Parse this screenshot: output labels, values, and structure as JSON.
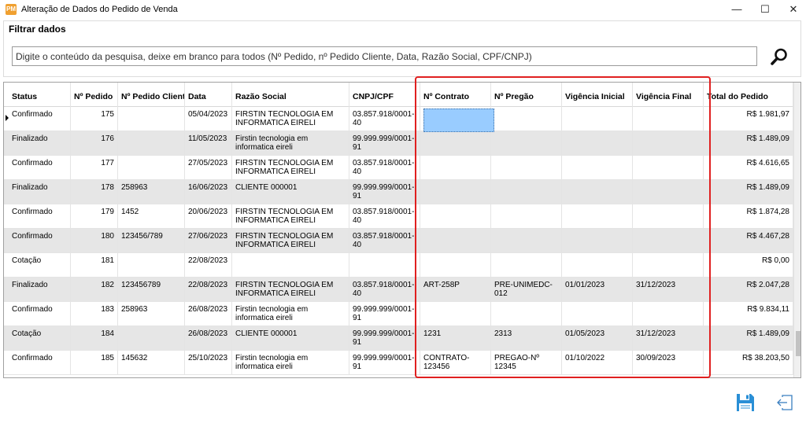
{
  "window": {
    "title": "Alteração de Dados do Pedido de Venda",
    "app_icon_text": "PM",
    "minimize_glyph": "—",
    "maximize_glyph": "☐",
    "close_glyph": "✕"
  },
  "filter": {
    "title": "Filtrar dados",
    "placeholder": "Digite o conteúdo da pesquisa, deixe em branco para todos (Nº Pedido, nº Pedido Cliente, Data, Razão Social, CPF/CNPJ)",
    "search_icon": "magnifier-icon"
  },
  "grid": {
    "columns": [
      "Status",
      "Nº Pedido",
      "Nº Pedido Cliente",
      "Data",
      "Razão Social",
      "CNPJ/CPF",
      "Nº Contrato",
      "Nº Pregão",
      "Vigência Inicial",
      "Vigência Final",
      "Total do Pedido"
    ],
    "rows": [
      {
        "status": "Confirmado",
        "pedido": "175",
        "pedido_cliente": "",
        "data": "05/04/2023",
        "razao": "FIRSTIN TECNOLOGIA EM INFORMATICA EIRELI",
        "cnpj": "03.857.918/0001-40",
        "contrato": "",
        "pregao": "",
        "vig_ini": "",
        "vig_fim": "",
        "total": "R$ 1.981,97"
      },
      {
        "status": "Finalizado",
        "pedido": "176",
        "pedido_cliente": "",
        "data": "11/05/2023",
        "razao": "Firstin tecnologia em informatica eireli",
        "cnpj": "99.999.999/0001-91",
        "contrato": "",
        "pregao": "",
        "vig_ini": "",
        "vig_fim": "",
        "total": "R$ 1.489,09"
      },
      {
        "status": "Confirmado",
        "pedido": "177",
        "pedido_cliente": "",
        "data": "27/05/2023",
        "razao": "FIRSTIN TECNOLOGIA EM INFORMATICA EIRELI",
        "cnpj": "03.857.918/0001-40",
        "contrato": "",
        "pregao": "",
        "vig_ini": "",
        "vig_fim": "",
        "total": "R$ 4.616,65"
      },
      {
        "status": "Finalizado",
        "pedido": "178",
        "pedido_cliente": "258963",
        "data": "16/06/2023",
        "razao": "CLIENTE 000001",
        "cnpj": "99.999.999/0001-91",
        "contrato": "",
        "pregao": "",
        "vig_ini": "",
        "vig_fim": "",
        "total": "R$ 1.489,09"
      },
      {
        "status": "Confirmado",
        "pedido": "179",
        "pedido_cliente": "1452",
        "data": "20/06/2023",
        "razao": "FIRSTIN TECNOLOGIA EM INFORMATICA EIRELI",
        "cnpj": "03.857.918/0001-40",
        "contrato": "",
        "pregao": "",
        "vig_ini": "",
        "vig_fim": "",
        "total": "R$ 1.874,28"
      },
      {
        "status": "Confirmado",
        "pedido": "180",
        "pedido_cliente": "123456/789",
        "data": "27/06/2023",
        "razao": "FIRSTIN TECNOLOGIA EM INFORMATICA EIRELI",
        "cnpj": "03.857.918/0001-40",
        "contrato": "",
        "pregao": "",
        "vig_ini": "",
        "vig_fim": "",
        "total": "R$ 4.467,28"
      },
      {
        "status": "Cotação",
        "pedido": "181",
        "pedido_cliente": "",
        "data": "22/08/2023",
        "razao": "",
        "cnpj": "",
        "contrato": "",
        "pregao": "",
        "vig_ini": "",
        "vig_fim": "",
        "total": "R$ 0,00"
      },
      {
        "status": "Finalizado",
        "pedido": "182",
        "pedido_cliente": "123456789",
        "data": "22/08/2023",
        "razao": "FIRSTIN TECNOLOGIA EM INFORMATICA EIRELI",
        "cnpj": "03.857.918/0001-40",
        "contrato": "ART-258P",
        "pregao": "PRE-UNIMEDC-012",
        "vig_ini": "01/01/2023",
        "vig_fim": "31/12/2023",
        "total": "R$ 2.047,28"
      },
      {
        "status": "Confirmado",
        "pedido": "183",
        "pedido_cliente": "258963",
        "data": "26/08/2023",
        "razao": "Firstin tecnologia em informatica eireli",
        "cnpj": "99.999.999/0001-91",
        "contrato": "",
        "pregao": "",
        "vig_ini": "",
        "vig_fim": "",
        "total": "R$ 9.834,11"
      },
      {
        "status": "Cotação",
        "pedido": "184",
        "pedido_cliente": "",
        "data": "26/08/2023",
        "razao": "CLIENTE 000001",
        "cnpj": "99.999.999/0001-91",
        "contrato": "1231",
        "pregao": "2313",
        "vig_ini": "01/05/2023",
        "vig_fim": "31/12/2023",
        "total": "R$ 1.489,09"
      },
      {
        "status": "Confirmado",
        "pedido": "185",
        "pedido_cliente": "145632",
        "data": "25/10/2023",
        "razao": "Firstin tecnologia em informatica eireli",
        "cnpj": "99.999.999/0001-91",
        "contrato": "CONTRATO-123456",
        "pregao": "PREGAO-Nº 12345",
        "vig_ini": "01/10/2022",
        "vig_fim": "30/09/2023",
        "total": "R$ 38.203,50"
      }
    ]
  },
  "footer": {
    "save_icon": "floppy-disk-icon",
    "exit_icon": "exit-icon"
  },
  "colors": {
    "alt_row": "#e6e6e6",
    "selected_cell": "#99ccff",
    "highlight_border": "#e02020",
    "save_icon": "#2a8fd6"
  }
}
